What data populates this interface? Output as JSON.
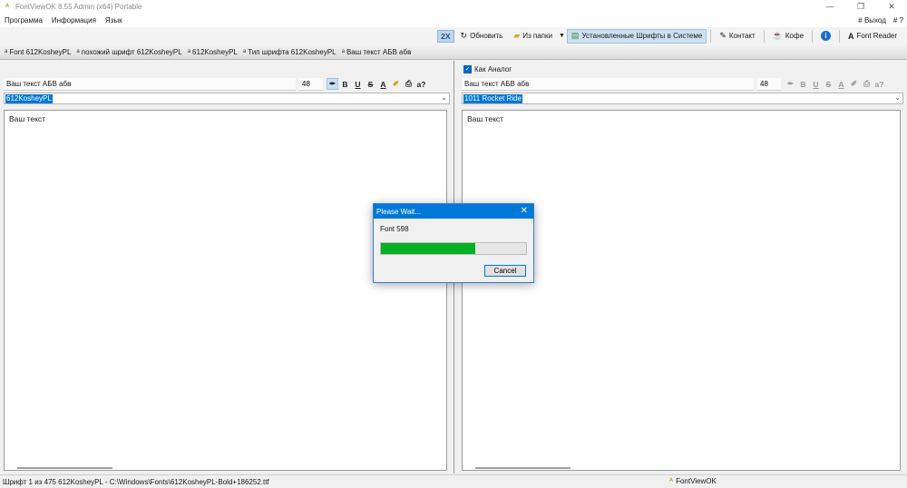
{
  "window": {
    "title": "FontViewOK 8.55 Admin (x64) Portable",
    "controls": {
      "minimize": "—",
      "restore": "❐",
      "close": "✕"
    }
  },
  "menu": {
    "items": [
      "Программа",
      "Информация",
      "Язык"
    ],
    "exit": "# Выход",
    "help": "# ?"
  },
  "toolbar": {
    "zoom": "2X",
    "refresh": "Обновить",
    "from_folder": "Из папки",
    "installed_fonts": "Установленные Шрифты в Системе",
    "contact": "Контакт",
    "coffee": "Кофе",
    "font_reader": "Font Reader"
  },
  "tabs": [
    {
      "label": "Font 612KosheyPL"
    },
    {
      "label": "похожий шрифт  612KosheyPL"
    },
    {
      "label": "612KosheyPL"
    },
    {
      "label": "Тип шрифта  612KosheyPL"
    },
    {
      "label": "Ваш текст АБВ абв"
    }
  ],
  "left_pane": {
    "text_input": "Ваш текст АБВ абв",
    "size": "48",
    "font": "612KosheyPL",
    "preview_text": "Ваш текст"
  },
  "right_pane": {
    "analog_label": "Как Аналог",
    "analog_checked": true,
    "text_input": "Ваш текст АБВ абв",
    "size": "48",
    "font": "1011 Rocket Ride",
    "preview_text": "Ваш текст"
  },
  "format_buttons": {
    "bold": "B",
    "underline": "U",
    "strike": "S",
    "help": "a?"
  },
  "dialog": {
    "title": "Please Wait...",
    "message": "Font 598",
    "progress_percent": 65,
    "cancel": "Cancel"
  },
  "status": {
    "text": "Шрифт 1 из 475 612KosheyPL - C:\\Windows\\Fonts\\612KosheyPL-Bold+186252.ttf",
    "app": "FontViewOK"
  },
  "colors": {
    "accent": "#0078d7",
    "progress": "#06b025",
    "selected_toolbar": "#cde0f1"
  }
}
